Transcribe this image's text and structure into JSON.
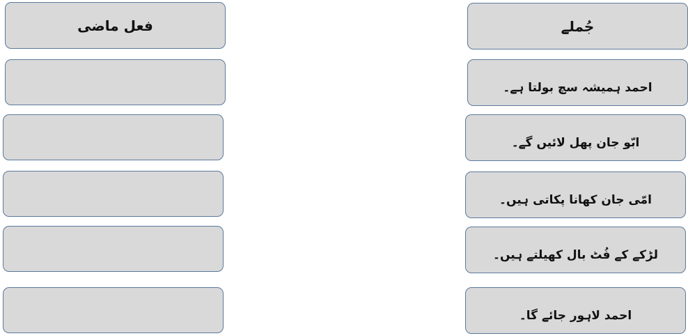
{
  "left_column": {
    "header": "فعل ماضی",
    "answers": [
      "",
      "",
      "",
      "",
      ""
    ]
  },
  "right_column": {
    "header": "جُملے",
    "sentences": [
      "احمد ہمیشہ سچ بولتا ہے۔",
      "ابّو جان پھل لائیں گے۔",
      "امّی جان کھانا پکاتی ہیں۔",
      "لڑکے کے فُٹ بال کھیلتے ہیں۔",
      "احمد لاہور جائے گا۔"
    ]
  }
}
